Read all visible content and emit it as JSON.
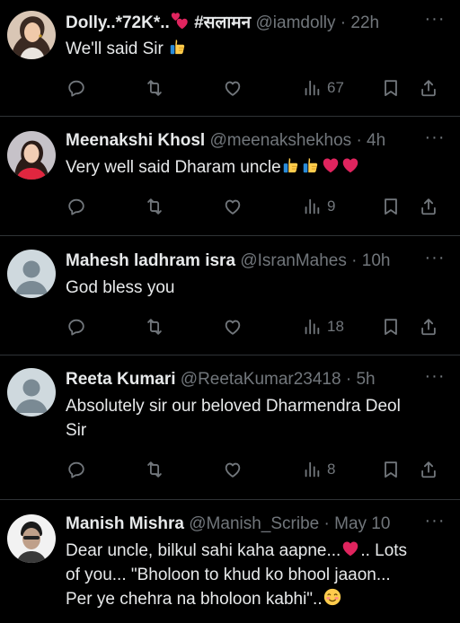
{
  "tweets": [
    {
      "display_name": "Dolly..*72K*..",
      "name_suffix": "#सलामन",
      "handle": "@iamdolly",
      "time": "22h",
      "text": "We'll said Sir",
      "text_line2": "",
      "views": "67",
      "avatar": "photo-woman"
    },
    {
      "display_name": "Meenakshi Khosl",
      "name_suffix": "",
      "handle": "@meenakshekhos",
      "time": "4h",
      "text": "Very well said Dharam uncle",
      "text_line2": "",
      "views": "9",
      "avatar": "photo-woman-red"
    },
    {
      "display_name": "Mahesh ladhram isra",
      "name_suffix": "",
      "handle": "@IsranMahes",
      "time": "10h",
      "text": "God bless you",
      "text_line2": "",
      "views": "18",
      "avatar": "default-avatar"
    },
    {
      "display_name": "Reeta Kumari",
      "name_suffix": "",
      "handle": "@ReetaKumar23418",
      "time": "5h",
      "text": "Absolutely sir our beloved Dharmendra Deol",
      "text_line2": "Sir",
      "views": "8",
      "avatar": "default-avatar"
    },
    {
      "display_name": "Manish Mishra",
      "name_suffix": "",
      "handle": "@Manish_Scribe",
      "time": "May 10",
      "text": "Dear uncle, bilkul sahi kaha aapne...",
      "text_line1_end": ".. Lots",
      "text_line2": "of you... \"Bholoon to khud ko bhool jaaon...",
      "text_line3": "Per ye chehra na bholoon kabhi\"..",
      "views": "",
      "avatar": "photo-man"
    }
  ],
  "separator": "·",
  "icons": {
    "more": "more-horizontal-icon",
    "reply": "reply-icon",
    "retweet": "retweet-icon",
    "like": "like-icon",
    "views": "views-icon",
    "bookmark": "bookmark-icon",
    "share": "share-icon"
  },
  "colors": {
    "background": "#000000",
    "text": "#e7e9ea",
    "secondary": "#71767b",
    "divider": "#2f3336",
    "heart_emoji": "#e0245e",
    "thumb_emoji": "#ffcc4d"
  }
}
